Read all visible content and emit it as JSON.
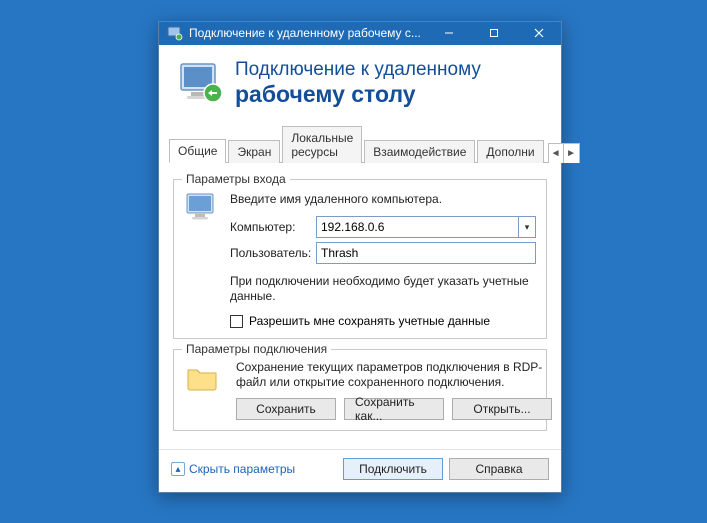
{
  "titlebar": {
    "title": "Подключение к удаленному рабочему с..."
  },
  "header": {
    "line1": "Подключение к удаленному",
    "line2": "рабочему столу"
  },
  "tabs": {
    "items": [
      {
        "label": "Общие"
      },
      {
        "label": "Экран"
      },
      {
        "label": "Локальные ресурсы"
      },
      {
        "label": "Взаимодействие"
      },
      {
        "label": "Дополни"
      }
    ]
  },
  "group_logon": {
    "legend": "Параметры входа",
    "intro": "Введите имя удаленного компьютера.",
    "computer_label": "Компьютер:",
    "computer_value": "192.168.0.6",
    "user_label": "Пользователь:",
    "user_value": "Thrash",
    "note": "При подключении необходимо будет указать учетные данные.",
    "checkbox_label": "Разрешить мне сохранять учетные данные"
  },
  "group_connection": {
    "legend": "Параметры подключения",
    "text": "Сохранение текущих параметров подключения в RDP-файл или открытие сохраненного подключения.",
    "save_label": "Сохранить",
    "saveas_label": "Сохранить как...",
    "open_label": "Открыть..."
  },
  "footer": {
    "collapse_label": "Скрыть параметры",
    "connect_label": "Подключить",
    "help_label": "Справка"
  }
}
